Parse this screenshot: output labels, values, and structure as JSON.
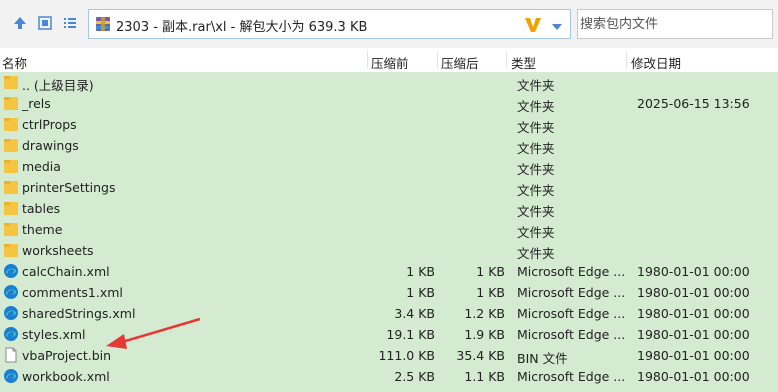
{
  "toolbar": {
    "up_icon": "up-arrow-icon",
    "view_icon": "details-view-icon",
    "list_icon": "list-view-icon",
    "path": "2303 - 副本.rar\\xl - 解包大小为 639.3 KB",
    "archive_icon": "rar-archive-icon",
    "v_icon": "v-logo-icon",
    "dropdown_icon": "chevron-down-icon",
    "search_placeholder": "搜索包内文件"
  },
  "columns": {
    "name": "名称",
    "compressed": "压缩前",
    "packed": "压缩后",
    "type": "类型",
    "modified": "修改日期"
  },
  "files": [
    {
      "icon": "folder-icon",
      "name": ".. (上级目录)",
      "compressed": "",
      "packed": "",
      "type": "文件夹",
      "modified": ""
    },
    {
      "icon": "folder-icon",
      "name": "_rels",
      "compressed": "",
      "packed": "",
      "type": "文件夹",
      "modified": "2025-06-15 13:56"
    },
    {
      "icon": "folder-icon",
      "name": "ctrlProps",
      "compressed": "",
      "packed": "",
      "type": "文件夹",
      "modified": ""
    },
    {
      "icon": "folder-icon",
      "name": "drawings",
      "compressed": "",
      "packed": "",
      "type": "文件夹",
      "modified": ""
    },
    {
      "icon": "folder-icon",
      "name": "media",
      "compressed": "",
      "packed": "",
      "type": "文件夹",
      "modified": ""
    },
    {
      "icon": "folder-icon",
      "name": "printerSettings",
      "compressed": "",
      "packed": "",
      "type": "文件夹",
      "modified": ""
    },
    {
      "icon": "folder-icon",
      "name": "tables",
      "compressed": "",
      "packed": "",
      "type": "文件夹",
      "modified": ""
    },
    {
      "icon": "folder-icon",
      "name": "theme",
      "compressed": "",
      "packed": "",
      "type": "文件夹",
      "modified": ""
    },
    {
      "icon": "folder-icon",
      "name": "worksheets",
      "compressed": "",
      "packed": "",
      "type": "文件夹",
      "modified": ""
    },
    {
      "icon": "edge-icon",
      "name": "calcChain.xml",
      "compressed": "1 KB",
      "packed": "1 KB",
      "type": "Microsoft Edge ...",
      "modified": "1980-01-01 00:00"
    },
    {
      "icon": "edge-icon",
      "name": "comments1.xml",
      "compressed": "1 KB",
      "packed": "1 KB",
      "type": "Microsoft Edge ...",
      "modified": "1980-01-01 00:00"
    },
    {
      "icon": "edge-icon",
      "name": "sharedStrings.xml",
      "compressed": "3.4 KB",
      "packed": "1.2 KB",
      "type": "Microsoft Edge ...",
      "modified": "1980-01-01 00:00"
    },
    {
      "icon": "edge-icon",
      "name": "styles.xml",
      "compressed": "19.1 KB",
      "packed": "1.9 KB",
      "type": "Microsoft Edge ...",
      "modified": "1980-01-01 00:00"
    },
    {
      "icon": "file-icon",
      "name": "vbaProject.bin",
      "compressed": "111.0 KB",
      "packed": "35.4 KB",
      "type": "BIN 文件",
      "modified": "1980-01-01 00:00"
    },
    {
      "icon": "edge-icon",
      "name": "workbook.xml",
      "compressed": "2.5 KB",
      "packed": "1.1 KB",
      "type": "Microsoft Edge ...",
      "modified": "1980-01-01 00:00"
    }
  ],
  "colors": {
    "list_background": "#d4ead1",
    "folder": "#f5c542",
    "annotation_arrow": "#e53935"
  }
}
